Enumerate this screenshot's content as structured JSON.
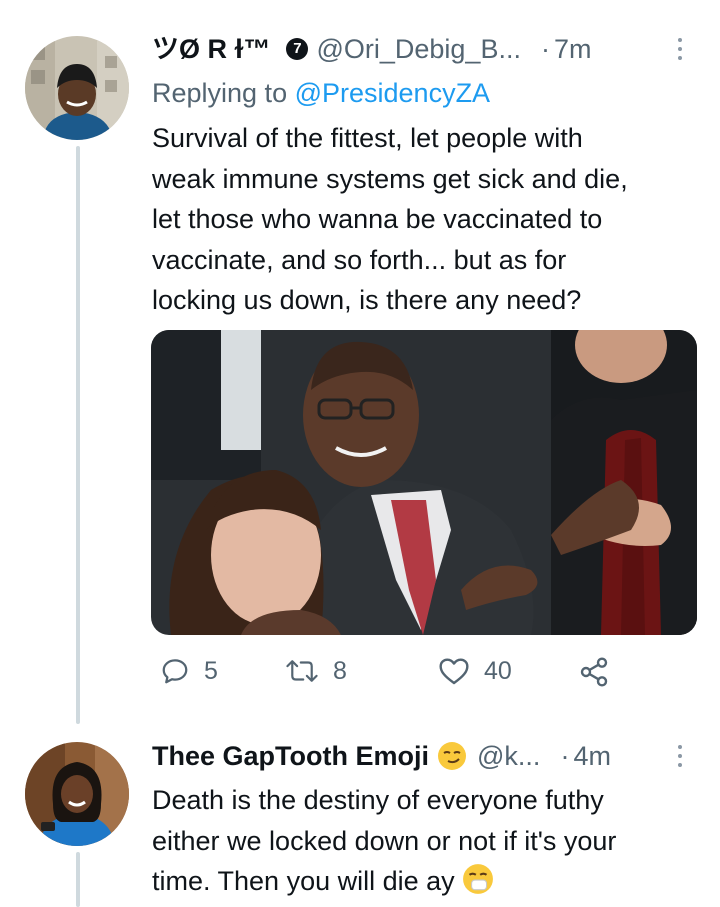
{
  "tweet1": {
    "display_name": "ツØ R ɫ™",
    "badge": "7",
    "handle": "@Ori_Debig_B...",
    "dot": "·",
    "time": "7m",
    "replying_prefix": "Replying to ",
    "replying_to": "@PresidencyZA",
    "text": "Survival of the fittest, let people with\nweak immune systems get sick and die,\nlet those who wanna be vaccinated to\nvaccinate, and so forth... but as for\nlocking us down, is there any need?",
    "replies": "5",
    "retweets": "8",
    "likes": "40"
  },
  "tweet2": {
    "display_name": "Thee GapTooth Emoji",
    "handle": "@k...",
    "dot": "·",
    "time": "4m",
    "text_line1": "Death is the destiny of everyone futhy",
    "text_line2": "either we locked down or not if it's your",
    "text_line3": "time. Then you will die ay"
  },
  "colors": {
    "text_primary": "#0f1419",
    "text_secondary": "#536471",
    "link": "#1d9bf0",
    "thread_line": "#cfd9de"
  },
  "icons": [
    "more-icon",
    "reply-icon",
    "retweet-icon",
    "like-icon",
    "share-icon",
    "smirk-emoji",
    "sneeze-emoji"
  ]
}
